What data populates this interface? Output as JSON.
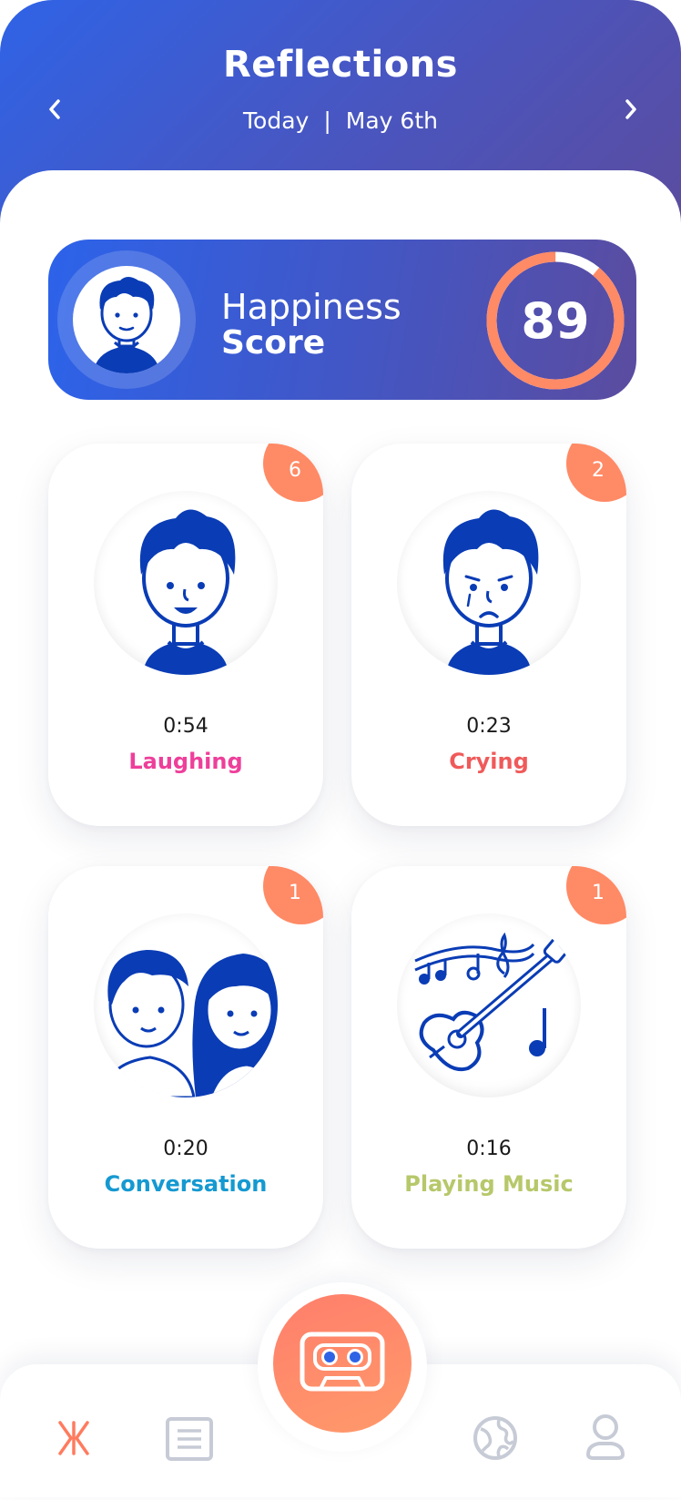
{
  "header": {
    "title": "Reflections",
    "day": "Today",
    "separator": "|",
    "date": "May 6th"
  },
  "score": {
    "label_top": "Happiness",
    "label_bottom": "Score",
    "value": "89",
    "progress": 0.89,
    "ring_color": "#ff8a66"
  },
  "cards": [
    {
      "badge": "6",
      "time": "0:54",
      "label": "Laughing",
      "color": "#ee3f9a",
      "icon": "laughing-boy-icon"
    },
    {
      "badge": "2",
      "time": "0:23",
      "label": "Crying",
      "color": "#f05a5a",
      "icon": "crying-boy-icon"
    },
    {
      "badge": "1",
      "time": "0:20",
      "label": "Conversation",
      "color": "#1599d1",
      "icon": "conversation-icon"
    },
    {
      "badge": "1",
      "time": "0:16",
      "label": "Playing Music",
      "color": "#b6c86a",
      "icon": "guitar-music-icon"
    }
  ],
  "nav": [
    "home-icon",
    "journal-icon",
    "record-cassette-icon",
    "globe-icon",
    "profile-icon"
  ],
  "colors": {
    "accent": "#ff8a66",
    "brand_blue": "#2f63e6",
    "illustration": "#0a3cb5"
  }
}
